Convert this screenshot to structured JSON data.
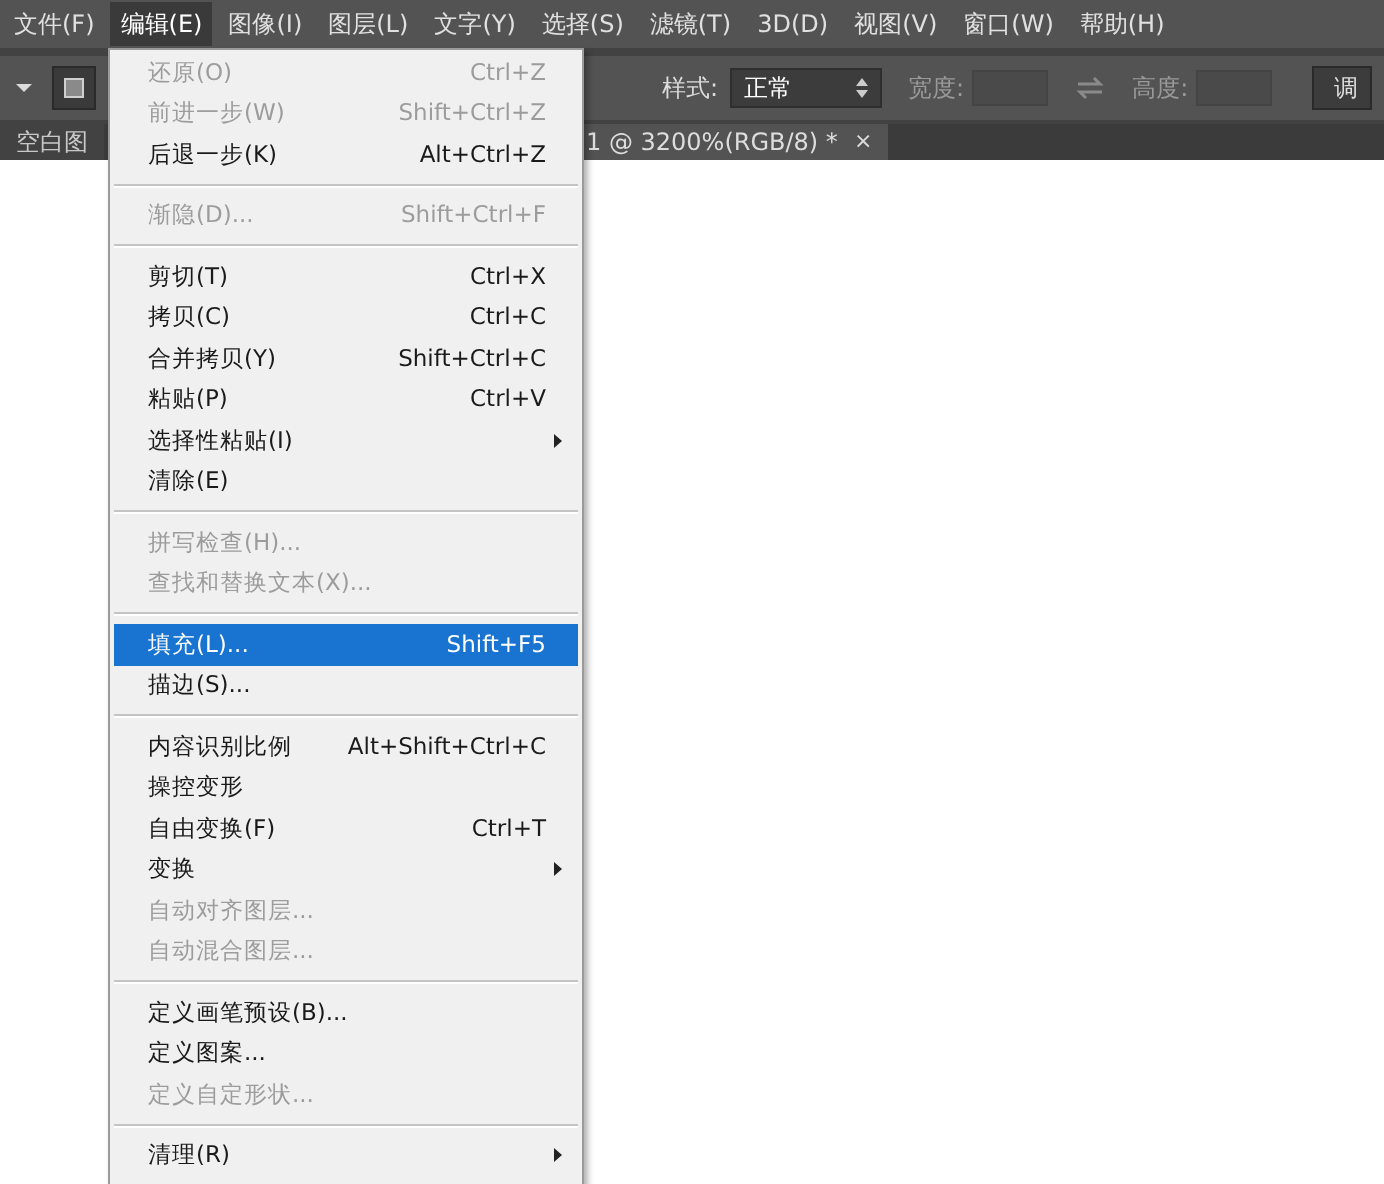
{
  "menu_bar": [
    {
      "label": "文件(F)",
      "selected": false
    },
    {
      "label": "编辑(E)",
      "selected": true
    },
    {
      "label": "图像(I)",
      "selected": false
    },
    {
      "label": "图层(L)",
      "selected": false
    },
    {
      "label": "文字(Y)",
      "selected": false
    },
    {
      "label": "选择(S)",
      "selected": false
    },
    {
      "label": "滤镜(T)",
      "selected": false
    },
    {
      "label": "3D(D)",
      "selected": false
    },
    {
      "label": "视图(V)",
      "selected": false
    },
    {
      "label": "窗口(W)",
      "selected": false
    },
    {
      "label": "帮助(H)",
      "selected": false
    }
  ],
  "options_bar": {
    "style_label": "样式:",
    "style_value": "正常",
    "width_label": "宽度:",
    "height_label": "高度:",
    "adjust_button": "调"
  },
  "document_tabs": [
    {
      "label": "空白图",
      "selected": false
    },
    {
      "label": "1 @ 3200%(RGB/8) *",
      "close": "×",
      "selected": true
    }
  ],
  "edit_menu": {
    "groups": [
      [
        {
          "label": "还原(O)",
          "shortcut": "Ctrl+Z",
          "disabled": true,
          "submenu": false,
          "selected": false
        },
        {
          "label": "前进一步(W)",
          "shortcut": "Shift+Ctrl+Z",
          "disabled": true,
          "submenu": false,
          "selected": false
        },
        {
          "label": "后退一步(K)",
          "shortcut": "Alt+Ctrl+Z",
          "disabled": false,
          "submenu": false,
          "selected": false
        }
      ],
      [
        {
          "label": "渐隐(D)...",
          "shortcut": "Shift+Ctrl+F",
          "disabled": true,
          "submenu": false,
          "selected": false
        }
      ],
      [
        {
          "label": "剪切(T)",
          "shortcut": "Ctrl+X",
          "disabled": false,
          "submenu": false,
          "selected": false
        },
        {
          "label": "拷贝(C)",
          "shortcut": "Ctrl+C",
          "disabled": false,
          "submenu": false,
          "selected": false
        },
        {
          "label": "合并拷贝(Y)",
          "shortcut": "Shift+Ctrl+C",
          "disabled": false,
          "submenu": false,
          "selected": false
        },
        {
          "label": "粘贴(P)",
          "shortcut": "Ctrl+V",
          "disabled": false,
          "submenu": false,
          "selected": false
        },
        {
          "label": "选择性粘贴(I)",
          "disabled": false,
          "submenu": true,
          "selected": false
        },
        {
          "label": "清除(E)",
          "disabled": false,
          "submenu": false,
          "selected": false
        }
      ],
      [
        {
          "label": "拼写检查(H)...",
          "disabled": true,
          "submenu": false,
          "selected": false
        },
        {
          "label": "查找和替换文本(X)...",
          "disabled": true,
          "submenu": false,
          "selected": false
        }
      ],
      [
        {
          "label": "填充(L)...",
          "shortcut": "Shift+F5",
          "disabled": false,
          "submenu": false,
          "selected": true
        },
        {
          "label": "描边(S)...",
          "disabled": false,
          "submenu": false,
          "selected": false
        }
      ],
      [
        {
          "label": "内容识别比例",
          "shortcut": "Alt+Shift+Ctrl+C",
          "disabled": false,
          "submenu": false,
          "selected": false
        },
        {
          "label": "操控变形",
          "disabled": false,
          "submenu": false,
          "selected": false
        },
        {
          "label": "自由变换(F)",
          "shortcut": "Ctrl+T",
          "disabled": false,
          "submenu": false,
          "selected": false
        },
        {
          "label": "变换",
          "disabled": false,
          "submenu": true,
          "selected": false
        },
        {
          "label": "自动对齐图层...",
          "disabled": true,
          "submenu": false,
          "selected": false
        },
        {
          "label": "自动混合图层...",
          "disabled": true,
          "submenu": false,
          "selected": false
        }
      ],
      [
        {
          "label": "定义画笔预设(B)...",
          "disabled": false,
          "submenu": false,
          "selected": false
        },
        {
          "label": "定义图案...",
          "disabled": false,
          "submenu": false,
          "selected": false
        },
        {
          "label": "定义自定形状...",
          "disabled": true,
          "submenu": false,
          "selected": false
        }
      ],
      [
        {
          "label": "清理(R)",
          "disabled": false,
          "submenu": true,
          "selected": false
        }
      ]
    ]
  }
}
